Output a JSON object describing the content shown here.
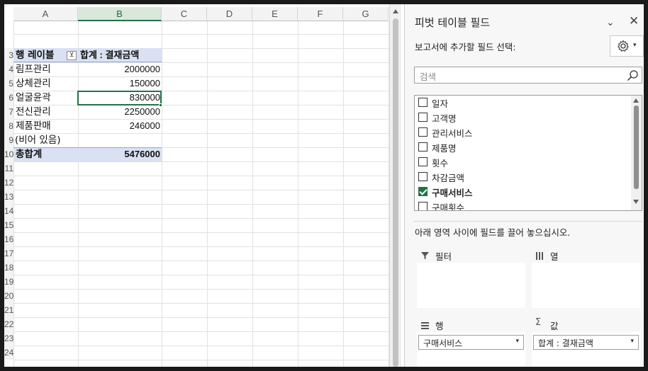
{
  "sheet": {
    "columns": [
      "A",
      "B",
      "C",
      "D",
      "E",
      "F",
      "G"
    ],
    "rows": [
      "",
      "",
      "3",
      "4",
      "5",
      "6",
      "7",
      "8",
      "9",
      "10",
      "11",
      "12",
      "13",
      "14",
      "15",
      "16",
      "17",
      "18",
      "19",
      "20",
      "21",
      "22",
      "23",
      "24"
    ],
    "pivot": {
      "row_label_header": "행 레이블",
      "value_header": "합계 : 결재금액",
      "filter_glyph": "⊻",
      "rows": [
        {
          "label": "림프관리",
          "value": "2000000"
        },
        {
          "label": "상체관리",
          "value": "150000"
        },
        {
          "label": "얼굴윤곽",
          "value": "830000"
        },
        {
          "label": "전신관리",
          "value": "2250000"
        },
        {
          "label": "제품판매",
          "value": "246000"
        },
        {
          "label": "(비어 있음)",
          "value": ""
        }
      ],
      "grand_total_label": "총합계",
      "grand_total_value": "5476000"
    }
  },
  "pane": {
    "title": "피벗 테이블 필드",
    "minimize_glyph": "⌄",
    "close_glyph": "✕",
    "choose_label": "보고서에 추가할 필드 선택:",
    "search_placeholder": "검색",
    "fields": [
      {
        "label": "일자",
        "checked": false
      },
      {
        "label": "고객명",
        "checked": false
      },
      {
        "label": "관리서비스",
        "checked": false
      },
      {
        "label": "제품명",
        "checked": false
      },
      {
        "label": "횟수",
        "checked": false
      },
      {
        "label": "차감금액",
        "checked": false
      },
      {
        "label": "구매서비스",
        "checked": true
      },
      {
        "label": "구매횟수",
        "checked": false
      }
    ],
    "drag_label": "아래 영역 사이에 필드를 끌어 놓으십시오.",
    "areas": {
      "filter": {
        "title": "필터"
      },
      "columns": {
        "title": "열"
      },
      "rows": {
        "title": "행",
        "item": "구매서비스"
      },
      "values": {
        "title": "값",
        "item": "합계 : 결재금액"
      }
    }
  },
  "colors": {
    "accent": "#217346",
    "pivot_header": "#d9e1f2"
  }
}
